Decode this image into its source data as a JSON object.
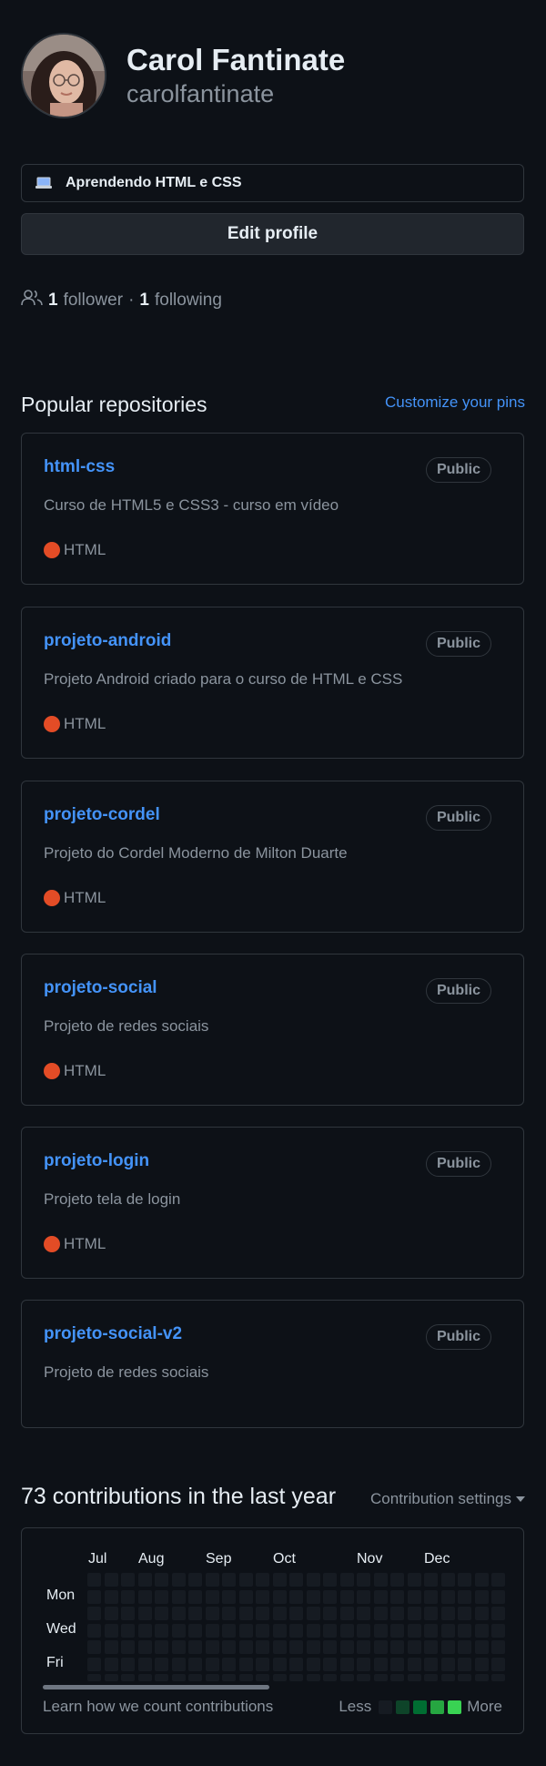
{
  "profile": {
    "full_name": "Carol Fantinate",
    "username": "carolfantinate",
    "status_text": "Aprendendo HTML e CSS",
    "edit_button": "Edit profile",
    "followers_count": "1",
    "followers_label": "follower",
    "following_count": "1",
    "following_label": "following"
  },
  "repos_section": {
    "title": "Popular repositories",
    "customize_link": "Customize your pins"
  },
  "repos": [
    {
      "name": "html-css",
      "visibility": "Public",
      "description": "Curso de HTML5 e CSS3 - curso em vídeo",
      "language": "HTML"
    },
    {
      "name": "projeto-android",
      "visibility": "Public",
      "description": "Projeto Android criado para o curso de HTML e CSS",
      "language": "HTML"
    },
    {
      "name": "projeto-cordel",
      "visibility": "Public",
      "description": "Projeto do Cordel Moderno de Milton Duarte",
      "language": "HTML"
    },
    {
      "name": "projeto-social",
      "visibility": "Public",
      "description": "Projeto de redes sociais",
      "language": "HTML"
    },
    {
      "name": "projeto-login",
      "visibility": "Public",
      "description": "Projeto tela de login",
      "language": "HTML"
    },
    {
      "name": "projeto-social-v2",
      "visibility": "Public",
      "description": "Projeto de redes sociais",
      "language": ""
    }
  ],
  "language_color": "#e34c26",
  "contributions": {
    "title": "73 contributions in the last year",
    "settings_label": "Contribution settings",
    "months": [
      "Jul",
      "Aug",
      "Sep",
      "Oct",
      "Nov",
      "Dec"
    ],
    "days": [
      "Mon",
      "Wed",
      "Fri"
    ],
    "learn_link": "Learn how we count contributions",
    "legend_less": "Less",
    "legend_more": "More",
    "legend_colors": [
      "#161b22",
      "#0e4429",
      "#006d32",
      "#26a641",
      "#39d353"
    ]
  },
  "icons": {
    "status_emoji": "laptop-icon",
    "people": "people-icon"
  }
}
